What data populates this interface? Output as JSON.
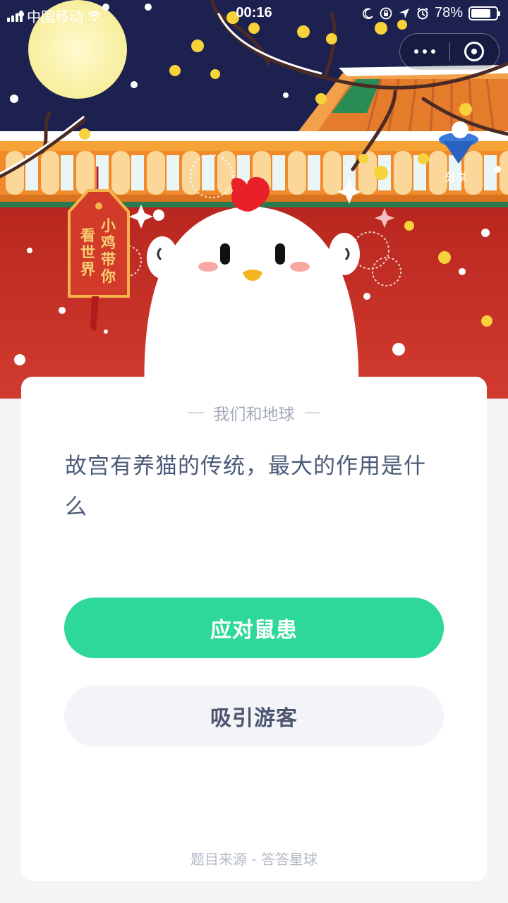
{
  "status_bar": {
    "carrier": "中国移动",
    "time": "00:16",
    "battery": "78%",
    "battery_level": 0.78
  },
  "capsule": {
    "more_icon": "more-dots-icon",
    "close_icon": "close-circle-icon"
  },
  "hero": {
    "tag_text_right": "小鸡带你",
    "tag_text_left": "看世界",
    "share_label": "分享"
  },
  "card": {
    "category": "我们和地球",
    "question": "故宫有养猫的传统，最大的作用是什么",
    "options": [
      {
        "label": "应对鼠患",
        "selected": true
      },
      {
        "label": "吸引游客",
        "selected": false
      }
    ],
    "source": "题目来源 - 答答星球"
  },
  "colors": {
    "primary_green": "#2ed898",
    "question_text": "#4b5a78",
    "wall_red": "#c8302a",
    "night_sky": "#1c2150"
  }
}
